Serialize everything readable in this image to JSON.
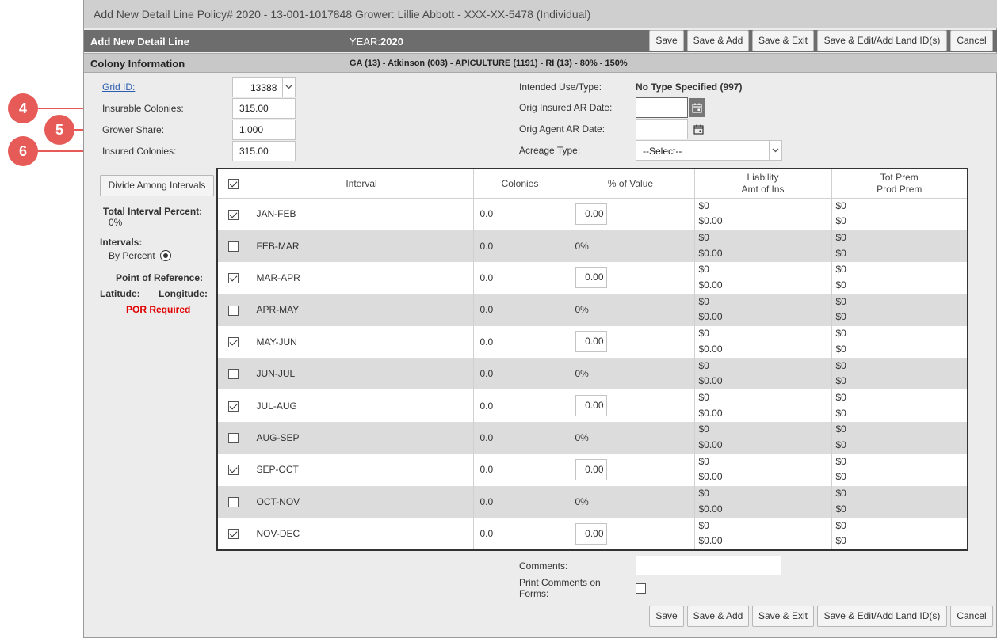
{
  "window": {
    "title": "Add New Detail Line Policy# 2020 - 13-001-1017848 Grower: Lillie Abbott - XXX-XX-5478 (Individual)"
  },
  "header": {
    "title": "Add New Detail Line",
    "year_label": "YEAR:",
    "year_value": "2020"
  },
  "buttons": {
    "save": "Save",
    "save_add": "Save & Add",
    "save_exit": "Save & Exit",
    "save_edit_land": "Save & Edit/Add Land ID(s)",
    "cancel": "Cancel"
  },
  "colony": {
    "section_title": "Colony Information",
    "summary": "GA (13) - Atkinson (003) - APICULTURE (1191) - RI (13) - 80% - 150%"
  },
  "form": {
    "grid_id_label": "Grid ID:",
    "grid_id_value": "13388",
    "insurable_label": "Insurable Colonies:",
    "insurable_value": "315.00",
    "grower_share_label": "Grower Share:",
    "grower_share_value": "1.000",
    "insured_label": "Insured Colonies:",
    "insured_value": "315.00",
    "intended_use_label": "Intended Use/Type:",
    "intended_use_value": "No Type Specified (997)",
    "orig_insured_label": "Orig Insured AR Date:",
    "orig_insured_value": "",
    "orig_agent_label": "Orig Agent AR Date:",
    "orig_agent_value": "",
    "acreage_label": "Acreage Type:",
    "acreage_value": "--Select--"
  },
  "callouts": [
    "4",
    "5",
    "6"
  ],
  "side": {
    "divide_button": "Divide Among Intervals",
    "total_pct_label": "Total Interval Percent:",
    "total_pct_value": "0%",
    "intervals_label": "Intervals:",
    "by_percent": "By Percent",
    "por_label": "Point of Reference:",
    "latitude": "Latitude:",
    "longitude": "Longitude:",
    "por_required": "POR Required"
  },
  "grid": {
    "headers": {
      "interval": "Interval",
      "colonies": "Colonies",
      "pct_value": "% of Value",
      "liability": "Liability",
      "amt_ins": "Amt of Ins",
      "tot_prem": "Tot Prem",
      "prod_prem": "Prod Prem"
    },
    "rows": [
      {
        "interval": "JAN-FEB",
        "checked": true,
        "colonies": "0.0",
        "pct": "0.00",
        "liability": "$0",
        "amt": "$0.00",
        "tot": "$0",
        "prod": "$0"
      },
      {
        "interval": "FEB-MAR",
        "checked": false,
        "colonies": "0.0",
        "pct": "0%",
        "liability": "$0",
        "amt": "$0.00",
        "tot": "$0",
        "prod": "$0"
      },
      {
        "interval": "MAR-APR",
        "checked": true,
        "colonies": "0.0",
        "pct": "0.00",
        "liability": "$0",
        "amt": "$0.00",
        "tot": "$0",
        "prod": "$0"
      },
      {
        "interval": "APR-MAY",
        "checked": false,
        "colonies": "0.0",
        "pct": "0%",
        "liability": "$0",
        "amt": "$0.00",
        "tot": "$0",
        "prod": "$0"
      },
      {
        "interval": "MAY-JUN",
        "checked": true,
        "colonies": "0.0",
        "pct": "0.00",
        "liability": "$0",
        "amt": "$0.00",
        "tot": "$0",
        "prod": "$0"
      },
      {
        "interval": "JUN-JUL",
        "checked": false,
        "colonies": "0.0",
        "pct": "0%",
        "liability": "$0",
        "amt": "$0.00",
        "tot": "$0",
        "prod": "$0"
      },
      {
        "interval": "JUL-AUG",
        "checked": true,
        "colonies": "0.0",
        "pct": "0.00",
        "liability": "$0",
        "amt": "$0.00",
        "tot": "$0",
        "prod": "$0"
      },
      {
        "interval": "AUG-SEP",
        "checked": false,
        "colonies": "0.0",
        "pct": "0%",
        "liability": "$0",
        "amt": "$0.00",
        "tot": "$0",
        "prod": "$0"
      },
      {
        "interval": "SEP-OCT",
        "checked": true,
        "colonies": "0.0",
        "pct": "0.00",
        "liability": "$0",
        "amt": "$0.00",
        "tot": "$0",
        "prod": "$0"
      },
      {
        "interval": "OCT-NOV",
        "checked": false,
        "colonies": "0.0",
        "pct": "0%",
        "liability": "$0",
        "amt": "$0.00",
        "tot": "$0",
        "prod": "$0"
      },
      {
        "interval": "NOV-DEC",
        "checked": true,
        "colonies": "0.0",
        "pct": "0.00",
        "liability": "$0",
        "amt": "$0.00",
        "tot": "$0",
        "prod": "$0"
      }
    ]
  },
  "footer": {
    "comments_label": "Comments:",
    "comments_value": "",
    "print_comments_label": "Print Comments on Forms:"
  },
  "icons": {
    "calendar": "calendar-icon",
    "dropdown": "chevron-down-icon",
    "radio": "radio-selected-icon"
  },
  "colors": {
    "header_bar": "#6d6d6d",
    "section_bar": "#c8c8c8",
    "callout": "#e65a57",
    "por_required": "#e00000",
    "link": "#2a5db0"
  }
}
